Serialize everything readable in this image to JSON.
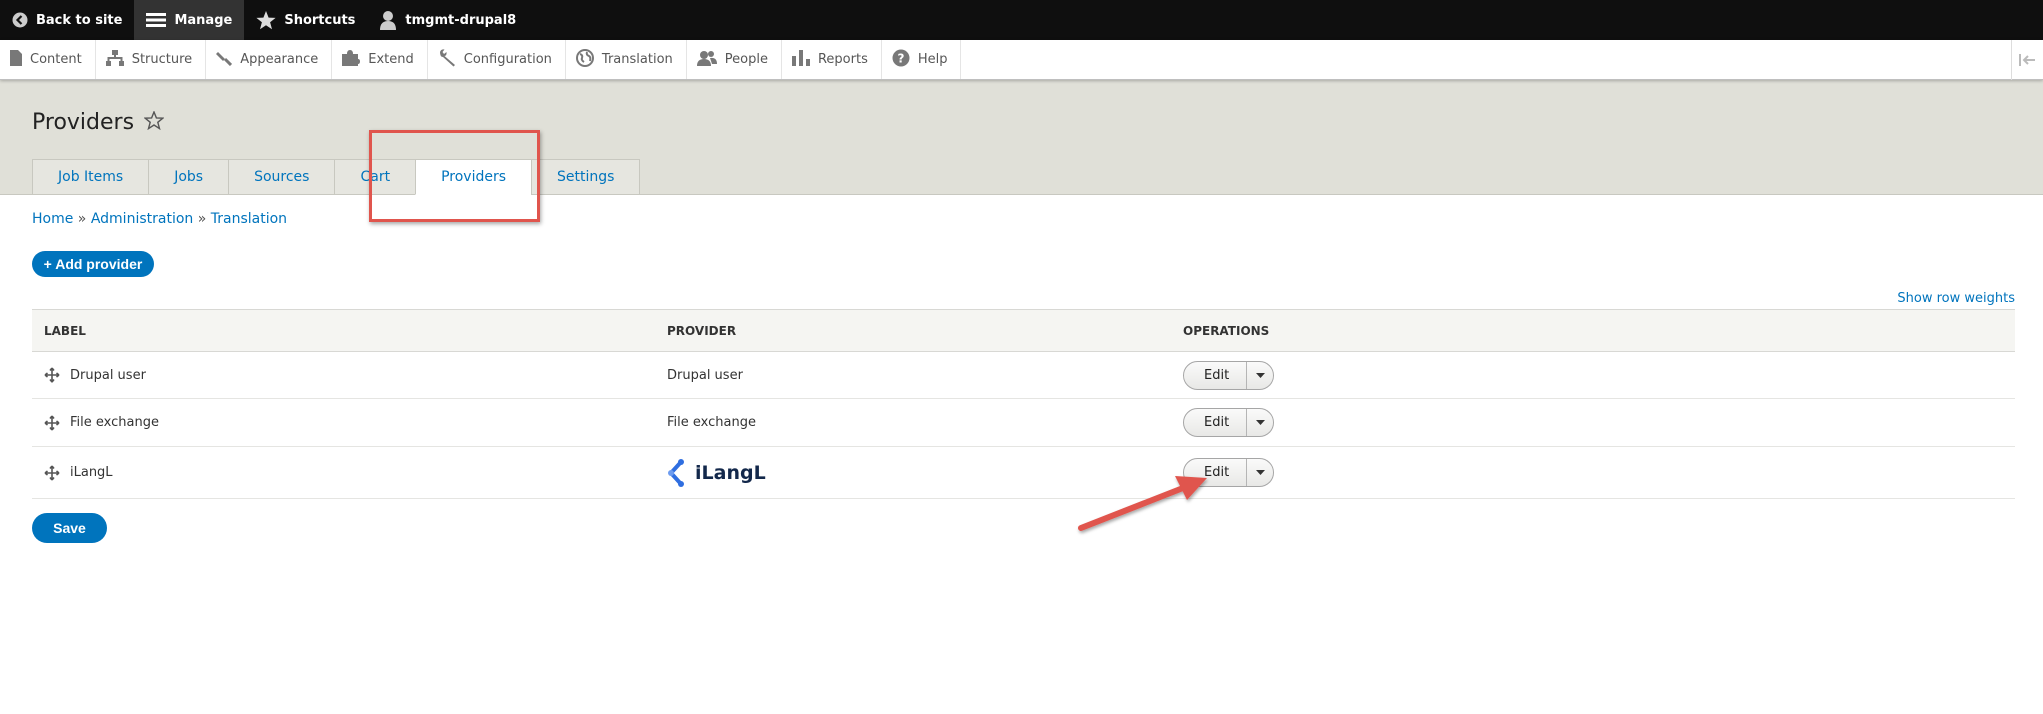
{
  "toolbar": {
    "back_label": "Back to site",
    "manage_label": "Manage",
    "shortcuts_label": "Shortcuts",
    "user_label": "tmgmt-drupal8"
  },
  "tray": {
    "items": [
      {
        "label": "Content",
        "icon": "file-icon"
      },
      {
        "label": "Structure",
        "icon": "structure-icon"
      },
      {
        "label": "Appearance",
        "icon": "brush-icon"
      },
      {
        "label": "Extend",
        "icon": "puzzle-icon"
      },
      {
        "label": "Configuration",
        "icon": "wrench-icon"
      },
      {
        "label": "Translation",
        "icon": "globe-icon"
      },
      {
        "label": "People",
        "icon": "people-icon"
      },
      {
        "label": "Reports",
        "icon": "chart-icon"
      },
      {
        "label": "Help",
        "icon": "help-icon"
      }
    ]
  },
  "page": {
    "title": "Providers",
    "tabs": [
      "Job Items",
      "Jobs",
      "Sources",
      "Cart",
      "Providers",
      "Settings"
    ],
    "active_tab": "Providers",
    "breadcrumb": [
      "Home",
      "Administration",
      "Translation"
    ],
    "breadcrumb_sep": "»",
    "add_button": "+ Add provider",
    "show_row_weights": "Show row weights",
    "save_button": "Save"
  },
  "table": {
    "headers": [
      "LABEL",
      "PROVIDER",
      "OPERATIONS"
    ],
    "rows": [
      {
        "label": "Drupal user",
        "provider": "Drupal user",
        "op": "Edit"
      },
      {
        "label": "File exchange",
        "provider": "File exchange",
        "op": "Edit"
      },
      {
        "label": "iLangL",
        "provider": "iLangL",
        "op": "Edit"
      }
    ]
  },
  "colors": {
    "link": "#0074bd",
    "annotation": "#e0554d"
  }
}
